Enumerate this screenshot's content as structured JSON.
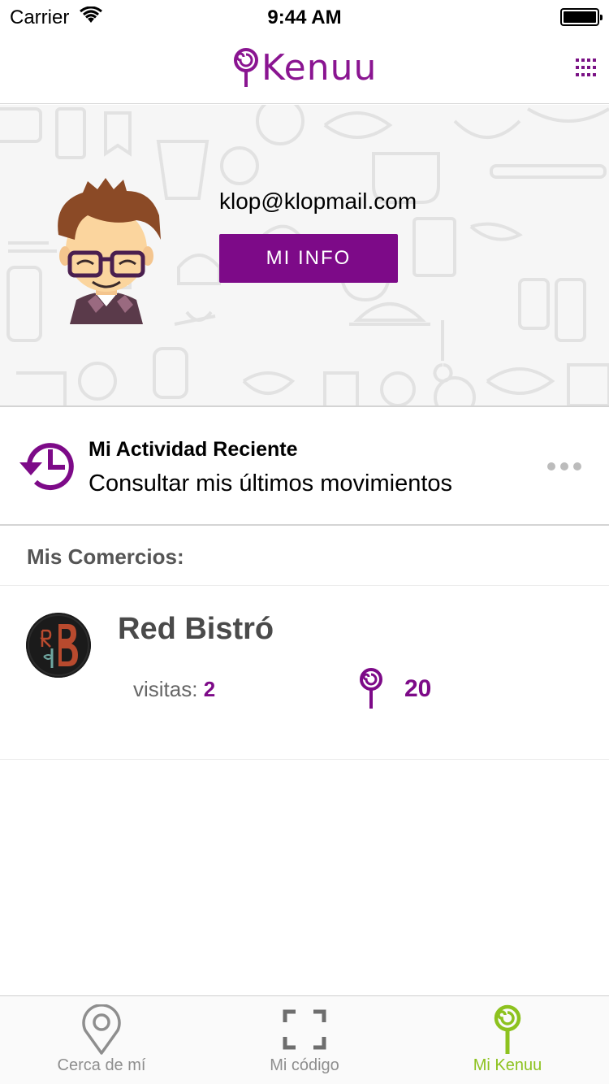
{
  "status_bar": {
    "carrier": "Carrier",
    "time": "9:44 AM"
  },
  "header": {
    "brand": "Kenuu"
  },
  "profile": {
    "email": "klop@klopmail.com",
    "info_button": "MI INFO"
  },
  "activity": {
    "title": "Mi Actividad Reciente",
    "subtitle": "Consultar mis últimos movimientos"
  },
  "merchants": {
    "section_title": "Mis Comercios:",
    "items": [
      {
        "name": "Red Bistró",
        "visits_label": "visitas:",
        "visits": "2",
        "points": "20"
      }
    ]
  },
  "tabbar": {
    "tabs": [
      {
        "label": "Cerca de mí",
        "icon": "location-pin-icon",
        "active": false
      },
      {
        "label": "Mi código",
        "icon": "scan-frame-icon",
        "active": false
      },
      {
        "label": "Mi Kenuu",
        "icon": "kenuu-lollipop-icon",
        "active": true
      }
    ]
  },
  "colors": {
    "brand_purple": "#7d0a88",
    "active_green": "#8dc21f",
    "text_gray": "#4a4a4a"
  }
}
